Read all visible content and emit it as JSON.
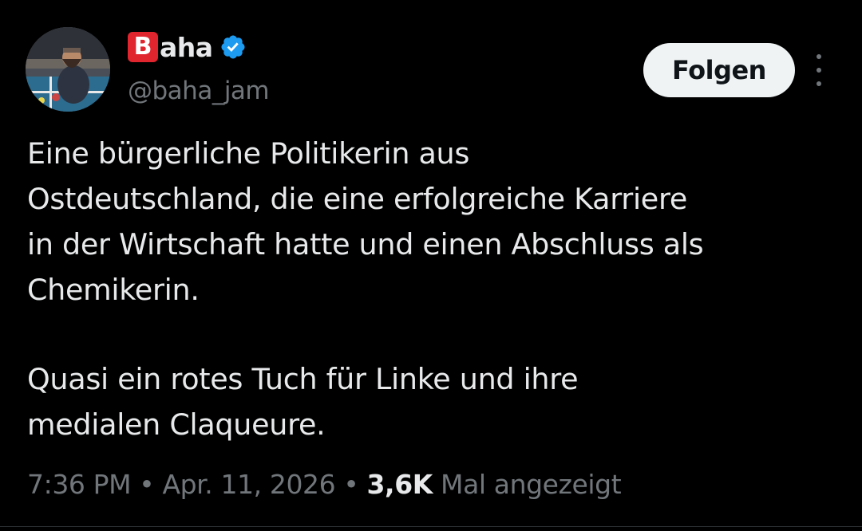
{
  "author": {
    "badge_letter": "B",
    "name_rest": "aha",
    "handle": "@baha_jam",
    "verified": true,
    "badge_color": "#e0252f",
    "verified_color": "#1d9bf0"
  },
  "actions": {
    "follow_label": "Folgen",
    "more_icon": "more-vertical-icon"
  },
  "tweet": {
    "paragraph1": [
      "Eine bürgerliche Politikerin aus",
      "Ostdeutschland, die eine erfolgreiche Karriere",
      "in der Wirtschaft hatte und einen Abschluss als",
      "Chemikerin."
    ],
    "paragraph2": [
      "Quasi ein rotes Tuch für Linke und ihre",
      "medialen Claqueure."
    ]
  },
  "meta": {
    "time": "7:36 PM",
    "separator": "•",
    "date": "Apr. 11, 2026",
    "views_count": "3,6K",
    "views_label": "Mal angezeigt"
  },
  "colors": {
    "background": "#000000",
    "text_primary": "#e7e9ea",
    "text_secondary": "#71767b",
    "button_bg": "#eff3f4",
    "button_text": "#0f1419"
  }
}
